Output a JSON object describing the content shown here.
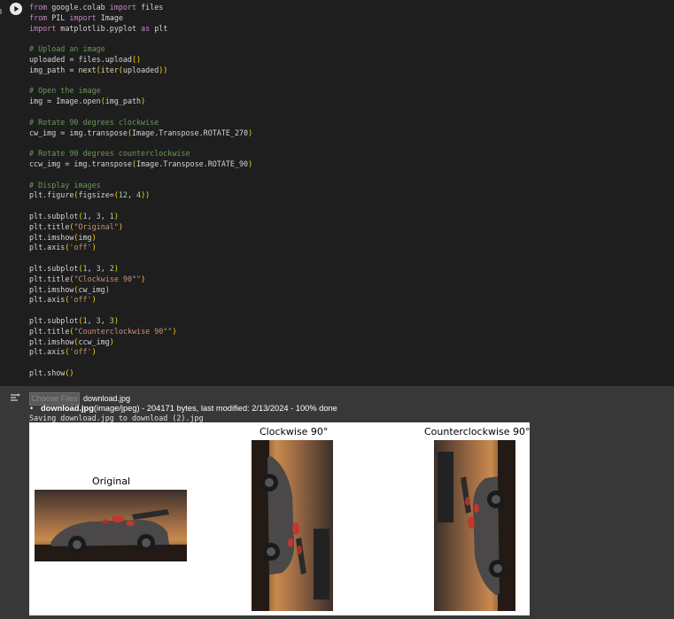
{
  "code_cell": {
    "lines": [
      [
        [
          "kw",
          "from"
        ],
        [
          "id",
          " google.colab "
        ],
        [
          "kw",
          "import"
        ],
        [
          "id",
          " files"
        ]
      ],
      [
        [
          "kw",
          "from"
        ],
        [
          "id",
          " PIL "
        ],
        [
          "kw",
          "import"
        ],
        [
          "id",
          " Image"
        ]
      ],
      [
        [
          "kw",
          "import"
        ],
        [
          "id",
          " matplotlib.pyplot "
        ],
        [
          "kw",
          "as"
        ],
        [
          "id",
          " plt"
        ]
      ],
      [],
      [
        [
          "cm",
          "# Upload an image"
        ]
      ],
      [
        [
          "id",
          "uploaded = files.upload"
        ],
        [
          "pn",
          "()"
        ]
      ],
      [
        [
          "id",
          "img_path = "
        ],
        [
          "fn",
          "next"
        ],
        [
          "pn",
          "("
        ],
        [
          "fn",
          "iter"
        ],
        [
          "pn",
          "("
        ],
        [
          "id",
          "uploaded"
        ],
        [
          "pn",
          "))"
        ]
      ],
      [],
      [
        [
          "cm",
          "# Open the image"
        ]
      ],
      [
        [
          "id",
          "img = Image.open"
        ],
        [
          "pn",
          "("
        ],
        [
          "id",
          "img_path"
        ],
        [
          "pn",
          ")"
        ]
      ],
      [],
      [
        [
          "cm",
          "# Rotate 90 degrees clockwise"
        ]
      ],
      [
        [
          "id",
          "cw_img = img.transpose"
        ],
        [
          "pn",
          "("
        ],
        [
          "id",
          "Image.Transpose.ROTATE_270"
        ],
        [
          "pn",
          ")"
        ]
      ],
      [],
      [
        [
          "cm",
          "# Rotate 90 degrees counterclockwise"
        ]
      ],
      [
        [
          "id",
          "ccw_img = img.transpose"
        ],
        [
          "pn",
          "("
        ],
        [
          "id",
          "Image.Transpose.ROTATE_90"
        ],
        [
          "pn",
          ")"
        ]
      ],
      [],
      [
        [
          "cm",
          "# Display images"
        ]
      ],
      [
        [
          "id",
          "plt.figure"
        ],
        [
          "pn",
          "("
        ],
        [
          "id",
          "figsize="
        ],
        [
          "pn",
          "("
        ],
        [
          "nm",
          "12"
        ],
        [
          "id",
          ", "
        ],
        [
          "nm",
          "4"
        ],
        [
          "pn",
          "))"
        ]
      ],
      [],
      [
        [
          "id",
          "plt.subplot"
        ],
        [
          "pn",
          "("
        ],
        [
          "nm",
          "1"
        ],
        [
          "id",
          ", "
        ],
        [
          "nm",
          "3"
        ],
        [
          "id",
          ", "
        ],
        [
          "nm",
          "1"
        ],
        [
          "pn",
          ")"
        ]
      ],
      [
        [
          "id",
          "plt.title"
        ],
        [
          "pn",
          "("
        ],
        [
          "st",
          "\"Original\""
        ],
        [
          "pn",
          ")"
        ]
      ],
      [
        [
          "id",
          "plt.imshow"
        ],
        [
          "pn",
          "("
        ],
        [
          "id",
          "img"
        ],
        [
          "pn",
          ")"
        ]
      ],
      [
        [
          "id",
          "plt.axis"
        ],
        [
          "pn",
          "("
        ],
        [
          "st",
          "'off'"
        ],
        [
          "pn",
          ")"
        ]
      ],
      [],
      [
        [
          "id",
          "plt.subplot"
        ],
        [
          "pn",
          "("
        ],
        [
          "nm",
          "1"
        ],
        [
          "id",
          ", "
        ],
        [
          "nm",
          "3"
        ],
        [
          "id",
          ", "
        ],
        [
          "nm",
          "2"
        ],
        [
          "pn",
          ")"
        ]
      ],
      [
        [
          "id",
          "plt.title"
        ],
        [
          "pn",
          "("
        ],
        [
          "st",
          "\"Clockwise 90°\""
        ],
        [
          "pn",
          ")"
        ]
      ],
      [
        [
          "id",
          "plt.imshow"
        ],
        [
          "pn",
          "("
        ],
        [
          "id",
          "cw_img"
        ],
        [
          "pn",
          ")"
        ]
      ],
      [
        [
          "id",
          "plt.axis"
        ],
        [
          "pn",
          "("
        ],
        [
          "st",
          "'off'"
        ],
        [
          "pn",
          ")"
        ]
      ],
      [],
      [
        [
          "id",
          "plt.subplot"
        ],
        [
          "pn",
          "("
        ],
        [
          "nm",
          "1"
        ],
        [
          "id",
          ", "
        ],
        [
          "nm",
          "3"
        ],
        [
          "id",
          ", "
        ],
        [
          "nm",
          "3"
        ],
        [
          "pn",
          ")"
        ]
      ],
      [
        [
          "id",
          "plt.title"
        ],
        [
          "pn",
          "("
        ],
        [
          "st",
          "\"Counterclockwise 90°\""
        ],
        [
          "pn",
          ")"
        ]
      ],
      [
        [
          "id",
          "plt.imshow"
        ],
        [
          "pn",
          "("
        ],
        [
          "id",
          "ccw_img"
        ],
        [
          "pn",
          ")"
        ]
      ],
      [
        [
          "id",
          "plt.axis"
        ],
        [
          "pn",
          "("
        ],
        [
          "st",
          "'off'"
        ],
        [
          "pn",
          ")"
        ]
      ],
      [],
      [
        [
          "id",
          "plt.show"
        ],
        [
          "pn",
          "()"
        ]
      ]
    ]
  },
  "output": {
    "choose_button_label": "Choose Files",
    "chosen_file": "download.jpg",
    "bullet": "•",
    "upload_filename": "download.jpg",
    "upload_detail": "(image/jpeg) - 204171 bytes, last modified: 2/13/2024 - 100% done",
    "saving_text": "Saving download.jpg to download (2).jpg"
  },
  "figure": {
    "titles": {
      "original": "Original",
      "clockwise": "Clockwise 90°",
      "counterclockwise": "Counterclockwise 90°"
    }
  },
  "colors": {
    "editor_bg": "#1e1e1e",
    "output_bg": "#383838",
    "keyword": "#c586c0",
    "comment": "#6a9955",
    "string": "#ce9178",
    "number": "#b5cea8",
    "function": "#dcdcaa",
    "bracket": "#ffd700"
  }
}
